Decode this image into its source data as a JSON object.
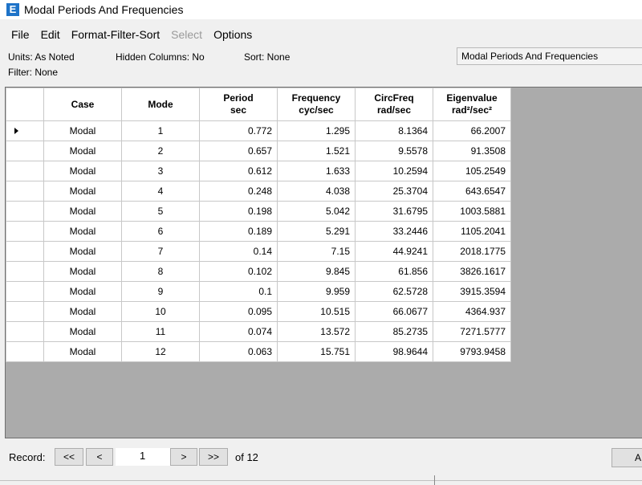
{
  "window": {
    "title": "Modal Periods And Frequencies",
    "icon_letter": "E"
  },
  "menu": [
    {
      "label": "File",
      "enabled": true
    },
    {
      "label": "Edit",
      "enabled": true
    },
    {
      "label": "Format-Filter-Sort",
      "enabled": true
    },
    {
      "label": "Select",
      "enabled": false
    },
    {
      "label": "Options",
      "enabled": true
    }
  ],
  "info": {
    "units": "Units:  As Noted",
    "hidden_columns": "Hidden Columns:  No",
    "sort": "Sort:  None",
    "filter": "Filter:  None",
    "table_select": "Modal Periods And Frequencies"
  },
  "table": {
    "headers": [
      {
        "line1": "Case",
        "line2": ""
      },
      {
        "line1": "Mode",
        "line2": ""
      },
      {
        "line1": "Period",
        "line2": "sec"
      },
      {
        "line1": "Frequency",
        "line2": "cyc/sec"
      },
      {
        "line1": "CircFreq",
        "line2": "rad/sec"
      },
      {
        "line1": "Eigenvalue",
        "line2": "rad²/sec²"
      }
    ],
    "rows": [
      [
        "Modal",
        "1",
        "0.772",
        "1.295",
        "8.1364",
        "66.2007"
      ],
      [
        "Modal",
        "2",
        "0.657",
        "1.521",
        "9.5578",
        "91.3508"
      ],
      [
        "Modal",
        "3",
        "0.612",
        "1.633",
        "10.2594",
        "105.2549"
      ],
      [
        "Modal",
        "4",
        "0.248",
        "4.038",
        "25.3704",
        "643.6547"
      ],
      [
        "Modal",
        "5",
        "0.198",
        "5.042",
        "31.6795",
        "1003.5881"
      ],
      [
        "Modal",
        "6",
        "0.189",
        "5.291",
        "33.2446",
        "1105.2041"
      ],
      [
        "Modal",
        "7",
        "0.14",
        "7.15",
        "44.9241",
        "2018.1775"
      ],
      [
        "Modal",
        "8",
        "0.102",
        "9.845",
        "61.856",
        "3826.1617"
      ],
      [
        "Modal",
        "9",
        "0.1",
        "9.959",
        "62.5728",
        "3915.3594"
      ],
      [
        "Modal",
        "10",
        "0.095",
        "10.515",
        "66.0677",
        "4364.937"
      ],
      [
        "Modal",
        "11",
        "0.074",
        "13.572",
        "85.2735",
        "7271.5777"
      ],
      [
        "Modal",
        "12",
        "0.063",
        "15.751",
        "98.9644",
        "9793.9458"
      ]
    ],
    "current_row": 0
  },
  "record_nav": {
    "label": "Record:",
    "first": "<<",
    "prev": "<",
    "current": "1",
    "next": ">",
    "last": ">>",
    "total": "of 12",
    "apply": "A"
  },
  "colors": {
    "grid_background": "#ababab",
    "icon_blue": "#1e73c8",
    "disabled_text": "#9a9a9a"
  }
}
